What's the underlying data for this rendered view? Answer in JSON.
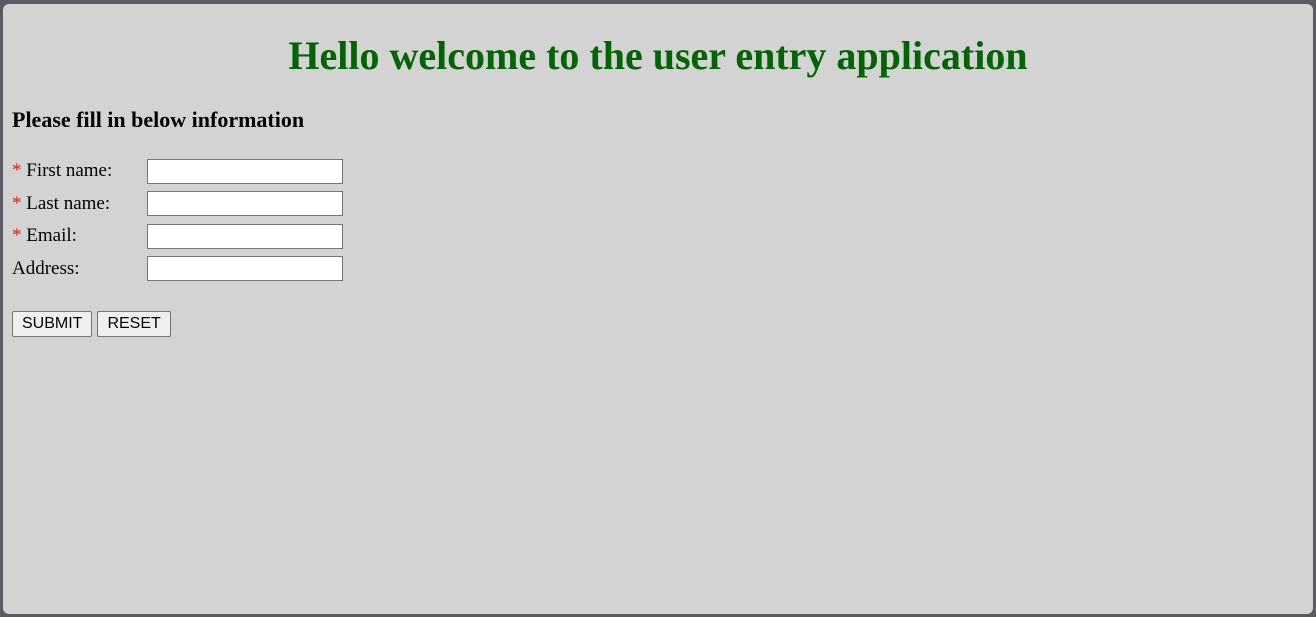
{
  "header": {
    "title": "Hello welcome to the user entry application",
    "title_color": "#006400"
  },
  "form": {
    "subtitle": "Please fill in below information",
    "required_marker": "*",
    "required_color": "#e02020",
    "fields": [
      {
        "label": "First name:",
        "required": true,
        "value": ""
      },
      {
        "label": "Last name:",
        "required": true,
        "value": ""
      },
      {
        "label": "Email:",
        "required": true,
        "value": ""
      },
      {
        "label": "Address:",
        "required": false,
        "value": ""
      }
    ]
  },
  "actions": {
    "submit_label": "SUBMIT",
    "reset_label": "RESET"
  },
  "colors": {
    "page_background": "#d3d3d3",
    "outer_frame": "#5b5b5f"
  }
}
